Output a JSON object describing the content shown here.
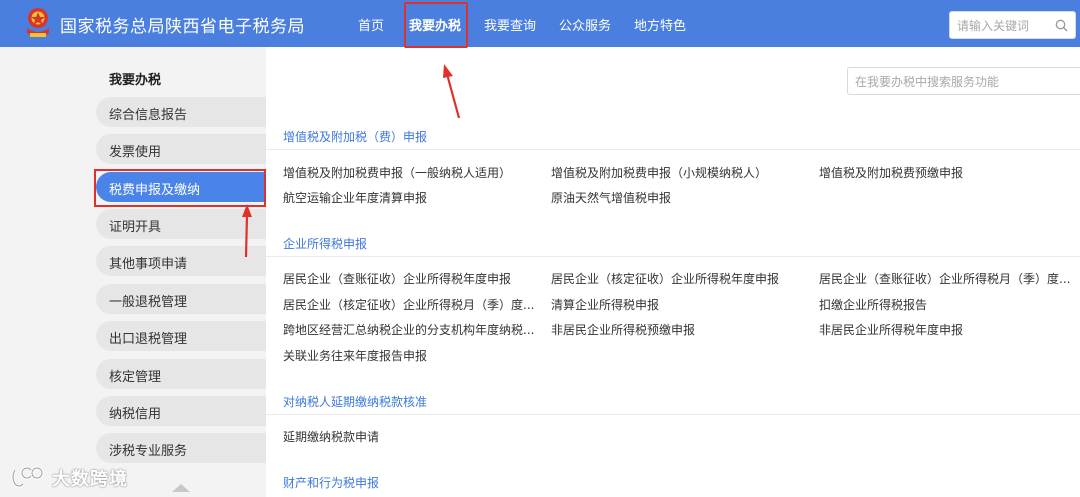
{
  "header": {
    "title": "国家税务总局陕西省电子税务局",
    "nav": [
      "首页",
      "我要办税",
      "我要查询",
      "公众服务",
      "地方特色"
    ],
    "active_nav": "我要办税",
    "search_placeholder": "请输入关键词"
  },
  "sidebar": {
    "heading": "我要办税",
    "items": [
      {
        "label": "综合信息报告"
      },
      {
        "label": "发票使用"
      },
      {
        "label": "税费申报及缴纳"
      },
      {
        "label": "证明开具"
      },
      {
        "label": "其他事项申请"
      },
      {
        "label": "一般退税管理"
      },
      {
        "label": "出口退税管理"
      },
      {
        "label": "核定管理"
      },
      {
        "label": "纳税信用"
      },
      {
        "label": "涉税专业服务"
      }
    ],
    "active_item": "税费申报及缴纳"
  },
  "main": {
    "search_placeholder": "在我要办税中搜索服务功能",
    "sections": [
      {
        "title": "增值税及附加税（费）申报",
        "items": [
          "增值税及附加税费申报（一般纳税人适用）",
          "增值税及附加税费申报（小规模纳税人）",
          "增值税及附加税费预缴申报",
          "航空运输企业年度清算申报",
          "原油天然气增值税申报"
        ]
      },
      {
        "title": "企业所得税申报",
        "items": [
          "居民企业（查账征收）企业所得税年度申报",
          "居民企业（核定征收）企业所得税年度申报",
          "居民企业（查账征收）企业所得税月（季）度...",
          "居民企业（核定征收）企业所得税月（季）度...",
          "清算企业所得税申报",
          "扣缴企业所得税报告",
          "跨地区经营汇总纳税企业的分支机构年度纳税...",
          "非居民企业所得税预缴申报",
          "非居民企业所得税年度申报",
          "关联业务往来年度报告申报"
        ]
      },
      {
        "title": "对纳税人延期缴纳税款核准",
        "items": [
          "延期缴纳税款申请"
        ]
      },
      {
        "title": "财产和行为税申报",
        "items": []
      }
    ]
  },
  "watermark": {
    "text": "大数跨境"
  },
  "colors": {
    "header_bg": "#4a7fe0",
    "active_item_bg": "#4a84e8",
    "section_title": "#3d78d9",
    "annotation_red": "#e0302b"
  }
}
